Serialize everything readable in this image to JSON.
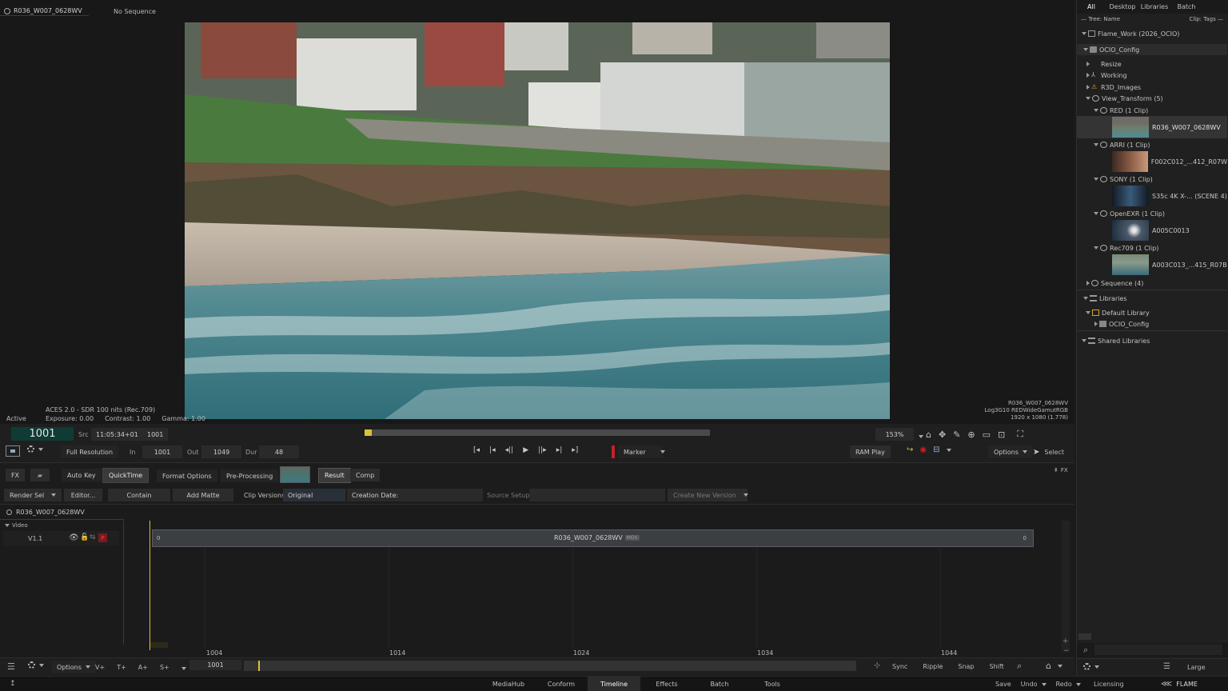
{
  "viewer": {
    "clip_name": "R036_W007_0628WV",
    "sequence_label": "No Sequence",
    "status": "Active",
    "color_info": "ACES 2.0 - SDR 100 nits (Rec.709)",
    "exposure": "Exposure: 0.00",
    "contrast": "Contrast: 1.00",
    "gamma": "Gamma: 1.00",
    "meta_name": "R036_W007_0628WV",
    "meta_space": "Log3G10 REDWideGamutRGB",
    "meta_res": "1920 x 1080 (1.778)"
  },
  "transport": {
    "frame": "1001",
    "src_label": "Src",
    "timecode": "11:05:34+01",
    "src_frame": "1001",
    "resolution": "Full Resolution",
    "in_label": "In",
    "in_value": "1001",
    "out_label": "Out",
    "out_value": "1049",
    "dur_label": "Dur",
    "dur_value": "48",
    "marker_label": "Marker",
    "zoom": "153%",
    "ram_play": "RAM Play",
    "options": "Options",
    "select": "Select",
    "playhead_progress": 0.0
  },
  "tools": {
    "fx": "FX",
    "auto_key": "Auto Key",
    "quicktime": "QuickTime",
    "format_options": "Format Options",
    "pre_processing": "Pre-Processing",
    "result": "Result",
    "comp": "Comp",
    "render_sel": "Render Sel",
    "editor": "Editor...",
    "contain": "Contain",
    "add_matte": "Add Matte",
    "clip_versions_label": "Clip Versions",
    "clip_versions_value": "Original",
    "creation_date": "Creation Date:",
    "source_setup": "Source Setup",
    "create_new_version": "Create New Version",
    "fx_toggle": "FX"
  },
  "timeline": {
    "clip_name": "R036_W007_0628WV",
    "video_label": "Video",
    "track_label": "V1.1",
    "segment_name": "R036_W007_0628WV",
    "segment_badge": "MOV",
    "seg_start": "0",
    "seg_end": "0",
    "p_badge": "P",
    "ruler": [
      "1004",
      "1014",
      "1024",
      "1034",
      "1044"
    ],
    "current_frame": "1001"
  },
  "timeline_toolbar": {
    "options": "Options",
    "v_plus": "V+",
    "t_plus": "T+",
    "a_plus": "A+",
    "s_plus": "S+",
    "sync": "Sync",
    "ripple": "Ripple",
    "snap": "Snap",
    "shift": "Shift"
  },
  "right_panel": {
    "tabs": [
      "All",
      "Desktop",
      "Libraries",
      "Batch"
    ],
    "tree_name": "— Tree: Name",
    "clip_tags": "Clip: Tags —",
    "project": "Flame_Work (2026_OCIO)",
    "ocio_config": "OCIO_Config",
    "resize": "Resize",
    "working": "Working",
    "r3d_images": "R3D_Images",
    "view_transform": "View_Transform (5)",
    "groups": [
      {
        "label": "RED (1 Clip)",
        "clip": "R036_W007_0628WV"
      },
      {
        "label": "ARRI (1 Clip)",
        "clip": "F002C012_...412_R07W"
      },
      {
        "label": "SONY (1 Clip)",
        "clip": "S35c 4K X-... (SCENE 4)"
      },
      {
        "label": "OpenEXR (1 Clip)",
        "clip": "A005C0013"
      },
      {
        "label": "Rec709 (1 Clip)",
        "clip": "A003C013_...415_R07B"
      }
    ],
    "sequence": "Sequence (4)",
    "libraries": "Libraries",
    "default_library": "Default Library",
    "lib_ocio": "OCIO_Config",
    "shared_libraries": "Shared Libraries",
    "size_label": "Large"
  },
  "bottom_bar": {
    "tabs": [
      "MediaHub",
      "Conform",
      "Timeline",
      "Effects",
      "Batch",
      "Tools"
    ],
    "active_tab": "Timeline",
    "save": "Save",
    "undo": "Undo",
    "redo": "Redo",
    "licensing": "Licensing",
    "brand": "FLAME"
  },
  "colors": {
    "accent_yellow": "#d9c236",
    "frame_green": "#0f3b34",
    "record_red": "#c4202a"
  }
}
